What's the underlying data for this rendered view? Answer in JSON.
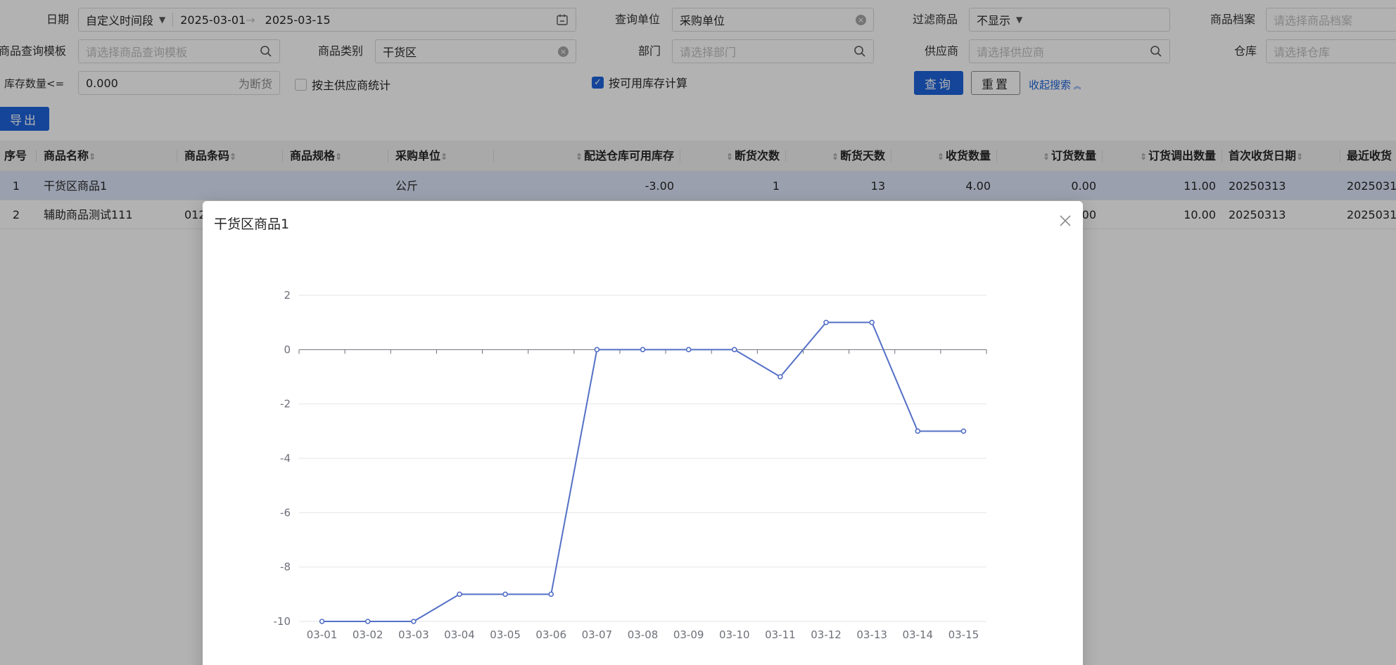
{
  "filters": {
    "date_label": "日期",
    "date_mode": "自定义时间段",
    "date_start": "2025-03-01",
    "date_range_arrow": "→",
    "date_end": "2025-03-15",
    "query_unit_label": "查询单位",
    "query_unit_value": "采购单位",
    "filter_product_label": "过滤商品",
    "filter_product_value": "不显示",
    "product_archive_label": "商品档案",
    "product_archive_placeholder": "请选择商品档案",
    "template_label": "商品查询模板",
    "template_placeholder": "请选择商品查询模板",
    "category_label": "商品类别",
    "category_value": "干货区",
    "dept_label": "部门",
    "dept_placeholder": "请选择部门",
    "supplier_label": "供应商",
    "supplier_placeholder": "请选择供应商",
    "warehouse_label": "仓库",
    "warehouse_placeholder": "请选择仓库",
    "stock_qty_label": "库存数量<=",
    "stock_qty_value": "0.000",
    "stock_qty_suffix": "为断货",
    "main_supplier_stat_label": "按主供应商统计",
    "main_supplier_stat_checked": false,
    "available_stock_calc_label": "按可用库存计算",
    "available_stock_calc_checked": true,
    "query_button": "查询",
    "reset_button": "重置",
    "collapse_link": "收起搜索",
    "export_button": "导出"
  },
  "table": {
    "columns": [
      "序号",
      "商品名称",
      "商品条码",
      "商品规格",
      "采购单位",
      "配送仓库可用库存",
      "断货次数",
      "断货天数",
      "收货数量",
      "订货数量",
      "订货调出数量",
      "首次收货日期",
      "最近收货"
    ],
    "rows": [
      [
        "1",
        "干货区商品1",
        "",
        "",
        "公斤",
        "-3.00",
        "1",
        "13",
        "4.00",
        "0.00",
        "11.00",
        "20250313",
        "2025031"
      ],
      [
        "2",
        "辅助商品测试111",
        "012",
        "",
        "",
        "",
        "",
        "",
        "",
        ".00",
        "10.00",
        "20250313",
        "2025031"
      ]
    ]
  },
  "modal": {
    "title": "干货区商品1"
  },
  "chart_data": {
    "type": "line",
    "title": "",
    "xlabel": "",
    "ylabel": "",
    "x": [
      "03-01",
      "03-02",
      "03-03",
      "03-04",
      "03-05",
      "03-06",
      "03-07",
      "03-08",
      "03-09",
      "03-10",
      "03-11",
      "03-12",
      "03-13",
      "03-14",
      "03-15"
    ],
    "series": [
      {
        "values": [
          -10,
          -10,
          -10,
          -9,
          -9,
          -9,
          0,
          0,
          0,
          0,
          -1,
          1,
          1,
          -3,
          -3
        ]
      }
    ],
    "ylim": [
      -10,
      2
    ],
    "yticks": [
      "2",
      "0",
      "-2",
      "-4",
      "-6",
      "-8",
      "-10"
    ],
    "grid": true,
    "line_color": "#5470c6"
  }
}
